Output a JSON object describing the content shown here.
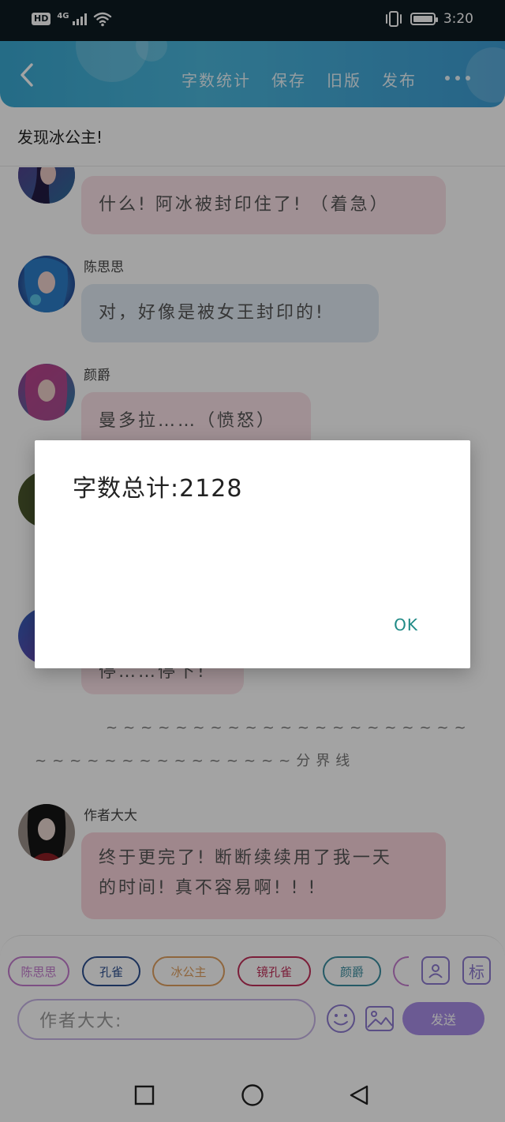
{
  "status_bar": {
    "hd": "HD",
    "network": "4G",
    "time": "3:20"
  },
  "header": {
    "menu": [
      "字数统计",
      "保存",
      "旧版",
      "发布"
    ],
    "colors": {
      "start": "#3aa9d2",
      "end": "#3d9dd4"
    }
  },
  "chapter_title": "发现冰公主!",
  "messages": [
    {
      "name": "",
      "text": "什么! 阿冰被封印住了! （着急）",
      "bubble_color": "#fbe2e8"
    },
    {
      "name": "陈思思",
      "text": "对，好像是被女王封印的!",
      "bubble_color": "#e1ebf4"
    },
    {
      "name": "颜爵",
      "text": "曼多拉……（愤怒）",
      "bubble_color": "#fbe2e8"
    },
    {
      "name": "",
      "text": "",
      "bubble_color": "#e1ebf4"
    },
    {
      "name": "",
      "text": "停……停下!",
      "bubble_color": "#fbe2e8"
    }
  ],
  "divider": {
    "line1": "~~~~~~~~~~~~~~~~~~~~~",
    "line2": "~~~~~~~~~~~~~~~分界线"
  },
  "author_message": {
    "name": "作者大大",
    "line1": "终于更完了! 断断续续用了我一天",
    "line2": "的时间! 真不容易啊! ! !"
  },
  "composer": {
    "roles": [
      {
        "label": "陈思思",
        "color": "#c47ccf"
      },
      {
        "label": "孔雀",
        "color": "#2c4f8f"
      },
      {
        "label": "冰公主",
        "color": "#e0a060"
      },
      {
        "label": "镜孔雀",
        "color": "#c0305a"
      },
      {
        "label": "颜爵",
        "color": "#3a8ea0"
      }
    ],
    "tag_icon_label": "标",
    "input_placeholder": "作者大大:",
    "send_label": "发送",
    "send_color": "#a88ee6"
  },
  "dialog": {
    "message": "字数总计:2128",
    "ok_label": "OK",
    "ok_color": "#1f8a86"
  }
}
